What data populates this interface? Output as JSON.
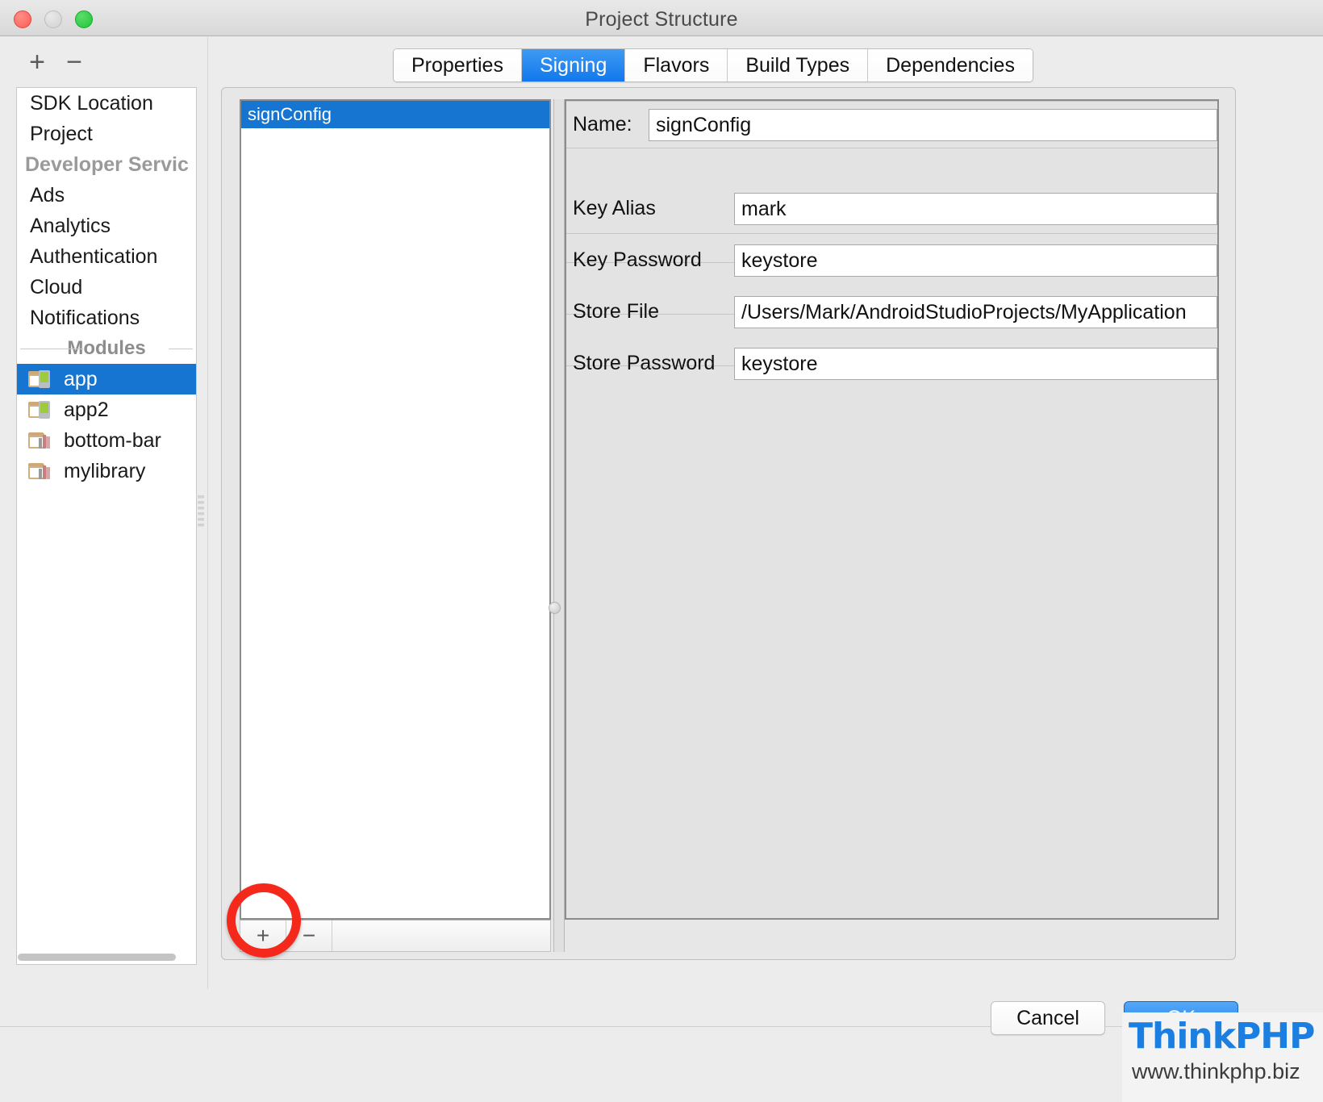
{
  "window": {
    "title": "Project Structure",
    "traffic_lights": [
      "close",
      "minimize",
      "maximize"
    ]
  },
  "sidebar": {
    "toolbar": {
      "add_label": "+",
      "remove_label": "−"
    },
    "items": [
      {
        "label": "SDK Location",
        "type": "item",
        "selected": false
      },
      {
        "label": "Project",
        "type": "item",
        "selected": false
      },
      {
        "label": "Developer Servic",
        "type": "group-header",
        "selected": false
      },
      {
        "label": "Ads",
        "type": "item",
        "selected": false
      },
      {
        "label": "Analytics",
        "type": "item",
        "selected": false
      },
      {
        "label": "Authentication",
        "type": "item",
        "selected": false
      },
      {
        "label": "Cloud",
        "type": "item",
        "selected": false
      },
      {
        "label": "Notifications",
        "type": "item",
        "selected": false
      }
    ],
    "modules_separator": "Modules",
    "modules": [
      {
        "label": "app",
        "icon": "folder-phone-icon",
        "selected": true
      },
      {
        "label": "app2",
        "icon": "folder-phone-icon",
        "selected": false
      },
      {
        "label": "bottom-bar",
        "icon": "folder-library-icon",
        "selected": false
      },
      {
        "label": "mylibrary",
        "icon": "folder-library-icon",
        "selected": false
      }
    ]
  },
  "tabs": [
    {
      "label": "Properties",
      "active": false
    },
    {
      "label": "Signing",
      "active": true
    },
    {
      "label": "Flavors",
      "active": false
    },
    {
      "label": "Build Types",
      "active": false
    },
    {
      "label": "Dependencies",
      "active": false
    }
  ],
  "signing": {
    "configs": [
      {
        "label": "signConfig",
        "selected": true
      }
    ],
    "list_toolbar": {
      "add_label": "+",
      "remove_label": "−"
    },
    "fields": [
      {
        "label": "Name:",
        "value": "signConfig"
      },
      {
        "label": "Key Alias",
        "value": "mark"
      },
      {
        "label": "Key Password",
        "value": "keystore"
      },
      {
        "label": "Store File",
        "value": "/Users/Mark/AndroidStudioProjects/MyApplication"
      },
      {
        "label": "Store Password",
        "value": "keystore"
      }
    ]
  },
  "footer": {
    "cancel_label": "Cancel",
    "ok_label": "OK"
  },
  "annotation": {
    "shape": "circle-highlight",
    "color": "#f4281b",
    "target": "add-signing-config-button"
  },
  "watermark": {
    "logo_text": "ThinkPHP",
    "url_text": "www.thinkphp.biz",
    "brand_color": "#1a7fe0"
  },
  "colors": {
    "selection_blue": "#1675d1",
    "tab_active_blue": "#1177ec",
    "annotation_red": "#f4281b"
  }
}
